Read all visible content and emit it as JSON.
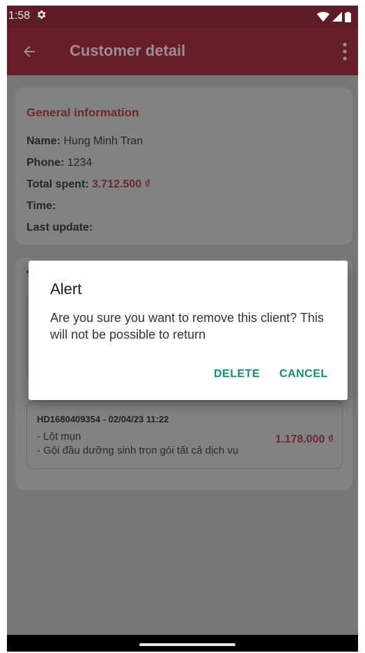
{
  "status_bar": {
    "time": "1:58",
    "icons": [
      "settings-gear-icon",
      "wifi-icon",
      "signal-icon",
      "battery-icon"
    ]
  },
  "app_bar": {
    "title": "Customer detail",
    "back_icon": "arrow-back-icon",
    "menu_icon": "more-vert-icon"
  },
  "general_info": {
    "title": "General information",
    "name_label": "Name:",
    "name_value": "Hung Minh Tran",
    "phone_label": "Phone:",
    "phone_value": "1234",
    "total_label": "Total spent:",
    "total_value": "3.712.500 ₫",
    "time_label": "Time:",
    "last_update_label": "Last update:"
  },
  "orders": [
    {
      "id": "HD1680409354 - 02/04/23 11:22",
      "items": [
        "- Lột mụn",
        "- Gội đầu dưỡng sinh trọn gói tất cả dịch vụ"
      ],
      "total": "1.178.000 ₫"
    }
  ],
  "dialog": {
    "title": "Alert",
    "message": "Are you sure you want to remove this client? This will not be possible to return",
    "delete_label": "DELETE",
    "cancel_label": "CANCEL"
  },
  "colors": {
    "status_bar": "#5e1c26",
    "app_bar": "#661f29",
    "accent": "#6b2a33",
    "dialog_button": "#0f8f7f"
  }
}
